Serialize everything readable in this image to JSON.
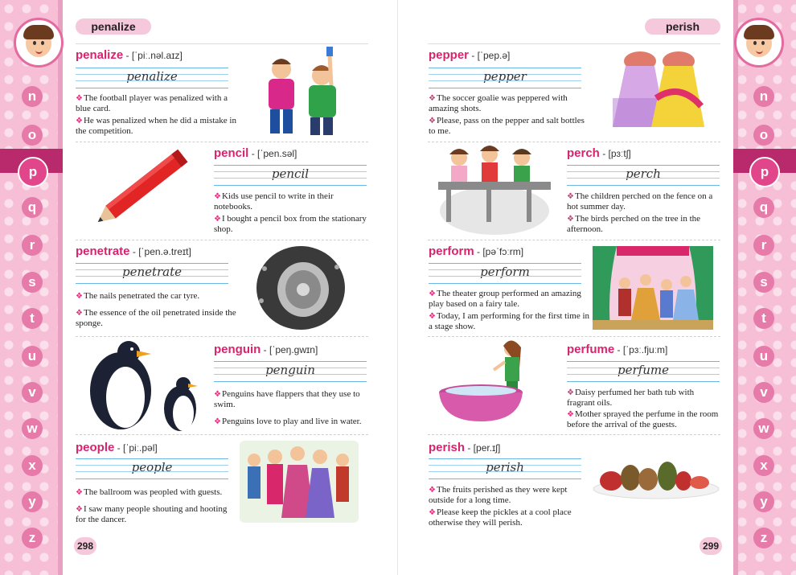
{
  "left_page": {
    "header": "penalize",
    "page_number": "298",
    "entries": [
      {
        "word": "penalize",
        "phonetic": " - [ˈpiː.nəl.aɪz]",
        "script": "penalize",
        "sentences": [
          "The football player was penalized with a blue card.",
          "He was penalized when he did a mistake in the competition."
        ]
      },
      {
        "word": "pencil",
        "phonetic": " - [ˈpen.səl]",
        "script": "pencil",
        "sentences": [
          "Kids use pencil to write in their notebooks.",
          "I bought a pencil box from the stationary shop."
        ]
      },
      {
        "word": "penetrate",
        "phonetic": " - [ˈpen.ə.treɪt]",
        "script": "penetrate",
        "sentences": [
          "The nails penetrated the car tyre.",
          "The essence of the oil penetrated inside the sponge."
        ]
      },
      {
        "word": "penguin",
        "phonetic": " - [ˈpeŋ.ɡwɪn]",
        "script": "penguin",
        "sentences": [
          "Penguins have flappers that they use to swim.",
          "Penguins love to play and live in water."
        ]
      },
      {
        "word": "people",
        "phonetic": " - [ˈpiː.pəl]",
        "script": "people",
        "sentences": [
          "The ballroom was peopled with guests.",
          "I saw many people shouting and hooting for the dancer."
        ]
      }
    ]
  },
  "right_page": {
    "header": "perish",
    "page_number": "299",
    "entries": [
      {
        "word": "pepper",
        "phonetic": " - [ˈpep.ə]",
        "script": "pepper",
        "sentences": [
          "The soccer goalie was peppered with amazing shots.",
          "Please, pass on the pepper and salt bottles to me."
        ]
      },
      {
        "word": "perch",
        "phonetic": " - [pɜːtʃ]",
        "script": "perch",
        "sentences": [
          "The children perched on the fence on a hot summer day.",
          "The birds perched on the tree in the afternoon."
        ]
      },
      {
        "word": "perform",
        "phonetic": " - [pəˈfɔːrm]",
        "script": "perform",
        "sentences": [
          "The theater group performed an amazing play based on a fairy tale.",
          "Today, I am performing for the first time in a stage show."
        ]
      },
      {
        "word": "perfume",
        "phonetic": " - [ˈpɜː.fjuːm]",
        "script": "perfume",
        "sentences": [
          "Daisy perfumed her bath tub with fragrant oils.",
          "Mother sprayed the perfume in the room before the arrival of the guests."
        ]
      },
      {
        "word": "perish",
        "phonetic": " - [per.ɪʃ]",
        "script": "perish",
        "sentences": [
          "The fruits perished as they were kept outside for a long time.",
          "Please keep the pickles at a cool place otherwise they will perish."
        ]
      }
    ]
  },
  "alphabet": [
    "n",
    "o",
    "p",
    "q",
    "r",
    "s",
    "t",
    "u",
    "v",
    "w",
    "x",
    "y",
    "z"
  ],
  "active_letter": "p",
  "bullet": "❖",
  "colors": {
    "rail": "#f6bfd6",
    "word": "#d6246e",
    "tab": "#b82a6b",
    "guide_lines": "#6bb7e6"
  }
}
